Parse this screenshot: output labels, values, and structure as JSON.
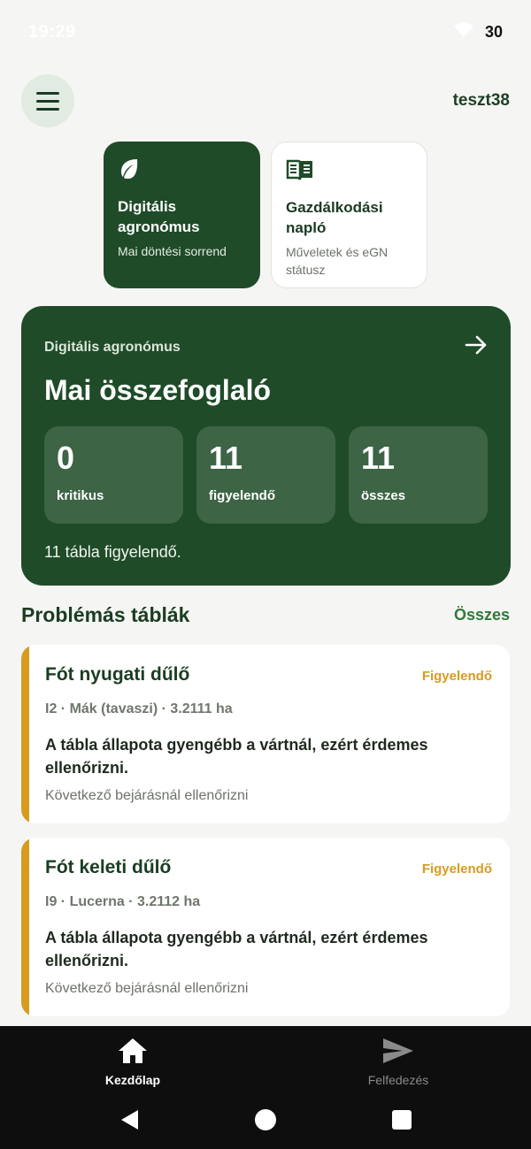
{
  "status_bar": {
    "time": "19:29",
    "battery": "30"
  },
  "header": {
    "username": "teszt38"
  },
  "quick_cards": [
    {
      "title": "Digitális agronómus",
      "subtitle": "Mai döntési sorrend",
      "icon": "leaf-icon"
    },
    {
      "title": "Gazdálkodási napló",
      "subtitle": "Műveletek és eGN státusz",
      "icon": "book-icon"
    }
  ],
  "summary": {
    "label": "Digitális agronómus",
    "title": "Mai összefoglaló",
    "stats": [
      {
        "value": "0",
        "label": "kritikus"
      },
      {
        "value": "11",
        "label": "figyelendő"
      },
      {
        "value": "11",
        "label": "összes"
      }
    ],
    "footer": "11 tábla figyelendő."
  },
  "section": {
    "title": "Problémás táblák",
    "link": "Összes"
  },
  "fields": [
    {
      "name": "Fót nyugati dűlő",
      "badge": "Figyelendő",
      "meta": "I2 · Mák (tavaszi) · 3.2111 ha",
      "description": "A tábla állapota gyengébb a vártnál, ezért érdemes ellenőrizni.",
      "next": "Következő bejárásnál ellenőrizni"
    },
    {
      "name": "Fót keleti dűlő",
      "badge": "Figyelendő",
      "meta": "I9 · Lucerna · 3.2112 ha",
      "description": "A tábla állapota gyengébb a vártnál, ezért érdemes ellenőrizni.",
      "next": "Következő bejárásnál ellenőrizni"
    }
  ],
  "bottom_nav": [
    {
      "label": "Kezdőlap",
      "icon": "home-icon",
      "active": true
    },
    {
      "label": "Felfedezés",
      "icon": "send-icon",
      "active": false
    }
  ],
  "colors": {
    "primary": "#1f4b28",
    "warning": "#d79b1f",
    "link": "#2f7a3a",
    "background": "#f5f6f3"
  }
}
